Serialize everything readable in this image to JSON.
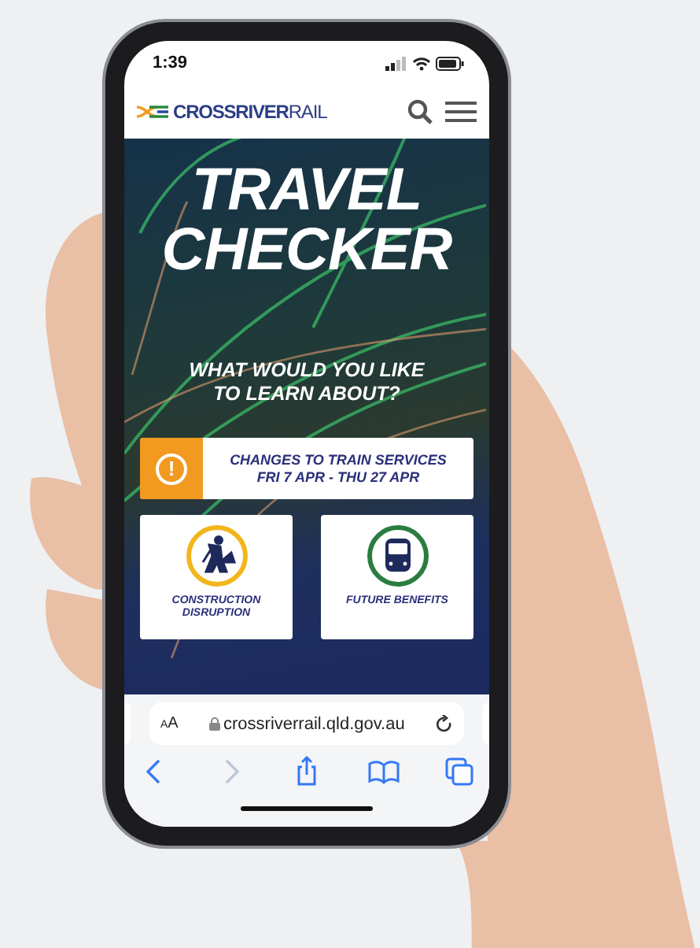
{
  "status_bar": {
    "time": "1:39"
  },
  "header": {
    "logo": "**CROSSRIVER**RAIL"
  },
  "hero": {
    "title": "TRAVEL CHECKER",
    "question": "WHAT WOULD YOU LIKE TO LEARN ABOUT?"
  },
  "alert": {
    "symbol": "!",
    "title": "CHANGES TO TRAIN SERVICES",
    "dates": "FRI 7 APR - THU 27 APR"
  },
  "cards": [
    {
      "kind": "construction",
      "label": "CONSTRUCTION DISRUPTION",
      "color": "#f2b51b"
    },
    {
      "kind": "benefits",
      "label": "FUTURE BENEFITS",
      "color": "#2a7d3f"
    }
  ],
  "browser": {
    "text_size": "AA",
    "url": "crossriverrail.qld.gov.au"
  },
  "toolbar": [
    {
      "kind": "back",
      "disabled": false
    },
    {
      "kind": "forward",
      "disabled": true
    },
    {
      "kind": "share",
      "disabled": false
    },
    {
      "kind": "bookmarks",
      "disabled": false
    },
    {
      "kind": "tabs",
      "disabled": false
    }
  ]
}
